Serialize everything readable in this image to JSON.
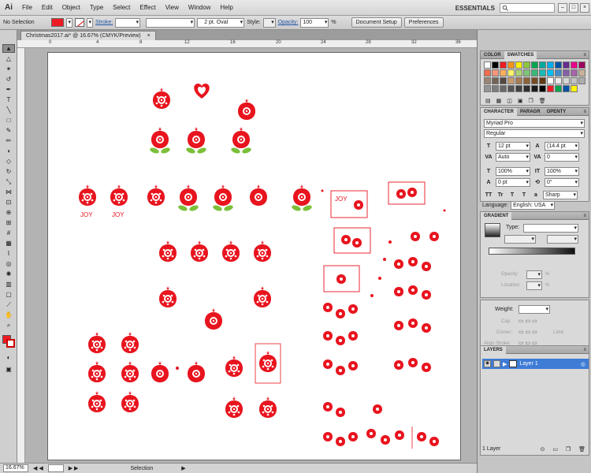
{
  "app": {
    "logo": "Ai",
    "menus": [
      "File",
      "Edit",
      "Object",
      "Type",
      "Select",
      "Effect",
      "View",
      "Window",
      "Help"
    ],
    "workspace": "ESSENTIALS"
  },
  "control": {
    "selection": "No Selection",
    "stroke_label": "Stroke:",
    "brush": "2 pt. Oval",
    "style_label": "Style:",
    "opacity_label": "Opacity:",
    "opacity_value": "100",
    "opacity_unit": "%",
    "doc_setup": "Document Setup",
    "preferences": "Preferences",
    "fill_color": "#ed1c24"
  },
  "document": {
    "tab_title": "Christmas2017.ai* @ 16.67% (CMYK/Preview)"
  },
  "ruler_labels": [
    "0",
    "4",
    "8",
    "12",
    "16",
    "20",
    "24",
    "28",
    "32",
    "36"
  ],
  "status": {
    "zoom": "16.67%",
    "mode": "Selection"
  },
  "panels": {
    "swatches": {
      "tabs": [
        "COLOR",
        "SWATCHES"
      ],
      "colors": [
        "#ffffff",
        "#000000",
        "#ed1c24",
        "#f7941d",
        "#fff200",
        "#8dc63f",
        "#00a651",
        "#00a99d",
        "#00aeef",
        "#0054a6",
        "#662d91",
        "#ec008c",
        "#9e005d",
        "#f26c4f",
        "#f69679",
        "#fbaf5d",
        "#fff568",
        "#acd373",
        "#7cc576",
        "#3bb878",
        "#1abbb4",
        "#00bff3",
        "#438ccb",
        "#8560a8",
        "#a864a8",
        "#c7b299",
        "#998675",
        "#736357",
        "#534741",
        "#c69c6d",
        "#a67c52",
        "#8c6239",
        "#754c24",
        "#603913",
        "#ffffff",
        "#ebebeb",
        "#d7d7d7",
        "#c2c2c2",
        "#acacac",
        "#959595",
        "#7d7d7d",
        "#686868",
        "#555555",
        "#414141",
        "#2e2e2e",
        "#1a1a1a",
        "#000000",
        "#ed1c24",
        "#00a651",
        "#0054a6",
        "#fff200"
      ]
    },
    "character": {
      "tabs": [
        "CHARACTER",
        "PARAGR",
        "OPENTY"
      ],
      "font": "Myriad Pro",
      "style": "Regular",
      "size": "12 pt",
      "leading": "(14.4 pt",
      "kerning": "Auto",
      "tracking": "0",
      "hscale": "100%",
      "vscale": "100%",
      "baseline": "0 pt",
      "rotation": "0°",
      "aa": "Sharp",
      "language_label": "Language:",
      "language": "English: USA"
    },
    "gradient": {
      "tab": "GRADIENT",
      "type_label": "Type:",
      "opacity_label": "Opacity:",
      "location_label": "Location:",
      "pct": "%"
    },
    "stroke": {
      "weight_label": "Weight:",
      "cap_label": "Cap:",
      "corner_label": "Corner:",
      "limit_label": "Limit:",
      "align_label": "Align Stroke:"
    },
    "layers": {
      "tab": "LAYERS",
      "layer_name": "Layer 1",
      "count": "1 Layer"
    }
  },
  "artwork": {
    "joy": "JOY",
    "red": "#e8141e",
    "green": "#7cbf3a"
  }
}
